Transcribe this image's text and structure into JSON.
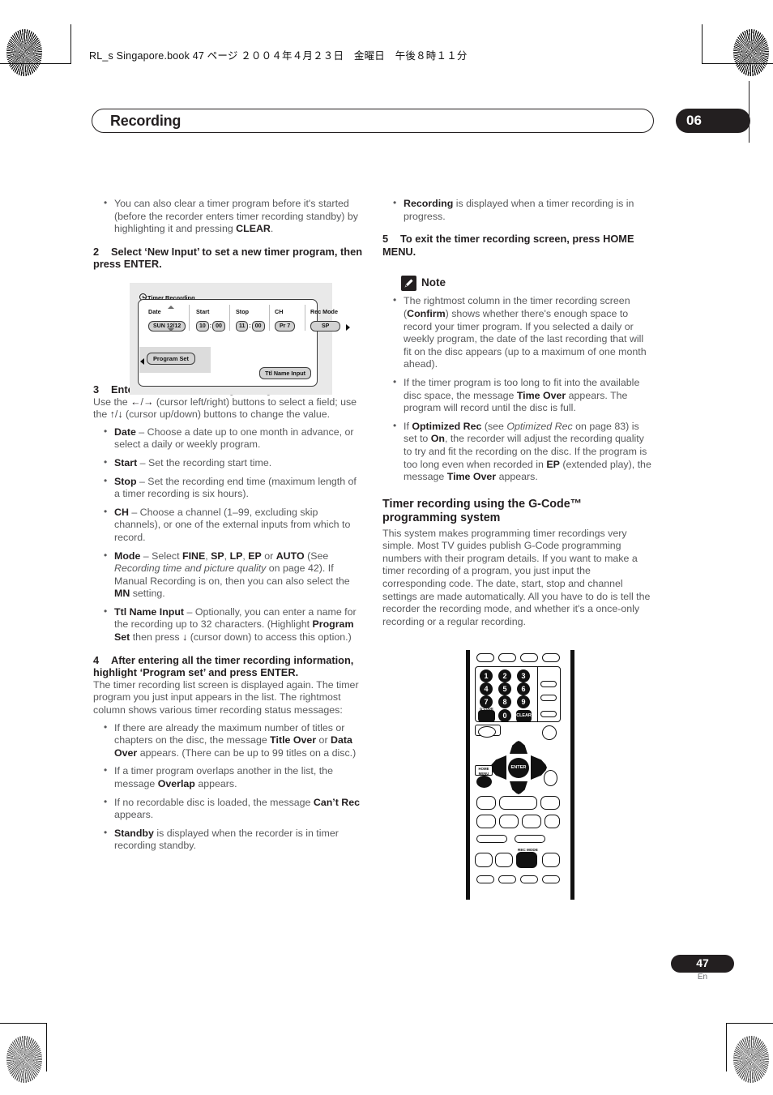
{
  "print_header": "RL_s Singapore.book  47 ページ  ２００４年４月２３日　金曜日　午後８時１１分",
  "running_head": {
    "title": "Recording",
    "chapter_number": "06"
  },
  "footer": {
    "page_number": "47",
    "language": "En"
  },
  "left_column": {
    "intro_bullets": [
      "You can also clear a timer program before it's started (before the recorder enters timer recording standby) by highlighting it and pressing <b>CLEAR</b>."
    ],
    "step2": {
      "number": "2",
      "text": "Select ‘New Input’ to set a new timer program, then press ENTER."
    },
    "osd": {
      "window_title": "Timer Recording",
      "clock_icon": "clock-icon",
      "columns": [
        {
          "label": "Date",
          "value": "SUN 12/12"
        },
        {
          "label": "Start",
          "value_hour": "10",
          "value_min": "00"
        },
        {
          "label": "Stop",
          "value_hour": "11",
          "value_min": "00"
        },
        {
          "label": "CH",
          "value": "Pr 7"
        },
        {
          "label": "Rec Mode",
          "value": "SP"
        }
      ],
      "program_set_button": "Program Set",
      "ttl_name_button": "Ttl Name Input"
    },
    "step3": {
      "number": "3",
      "text": "Enter the timer recording settings.",
      "body": "Use the <b>←</b>/<b>→</b> (cursor left/right) buttons to select a field; use the <b>↑</b>/<b>↓</b> (cursor up/down) buttons to change the value.",
      "bullets": [
        "<b>Date</b> – Choose a date up to one month in advance, or select a daily or weekly program.",
        "<b>Start</b> – Set the recording start time.",
        "<b>Stop</b> – Set the recording end time (maximum length of a timer recording is six hours).",
        "<b>CH</b> – Choose a channel (1–99, excluding skip channels), or one of the external inputs from which to record.",
        "<b>Mode</b> – Select <b>FINE</b>, <b>SP</b>, <b>LP</b>, <b>EP</b> or <b>AUTO</b> (See <i>Recording time and picture quality</i> on page 42). If Manual Recording is on, then you can also select the <b>MN</b> setting.",
        "<b>Ttl Name Input</b> – Optionally, you can enter a name for the recording up to 32 characters. (Highlight <b>Program Set</b> then press <b>↓</b> (cursor down) to access this option.)"
      ]
    },
    "step4": {
      "number": "4",
      "text": "After entering all the timer recording information, highlight ‘Program set’ and press ENTER.",
      "body": "The timer recording list screen is displayed again. The timer program you just input appears in the list. The rightmost column shows various timer recording status messages:",
      "bullets": [
        "If there are already the maximum number of titles or chapters on the disc, the message <b>Title Over</b> or <b>Data Over</b> appears. (There can be up to 99 titles on a disc.)",
        "If a timer program overlaps another in the list, the message <b>Overlap</b> appears.",
        "If no recordable disc is loaded, the message <b>Can’t Rec</b> appears.",
        "<b>Standby</b> is displayed when the recorder is in timer recording standby."
      ]
    }
  },
  "right_column": {
    "top_bullets": [
      "<b>Recording</b> is displayed when a timer recording is in progress."
    ],
    "step5": {
      "number": "5",
      "text": "To exit the timer recording screen, press HOME MENU."
    },
    "note": {
      "icon": "pencil-note-icon",
      "label": "Note",
      "bullets": [
        "The rightmost column in the timer recording screen (<b>Confirm</b>) shows whether there's enough space to record your timer program. If you selected a daily or weekly program, the date of the last recording that will fit on the disc appears (up to a maximum of one month ahead).",
        "If the timer program is too long to fit into the available disc space, the message <b>Time Over</b> appears. The program will record until the disc is full.",
        "If <b>Optimized Rec</b> (see <i>Optimized Rec</i> on page 83) is set to <b>On</b>, the recorder will adjust the recording quality to try and fit the recording on the disc. If the program is too long even when recorded in <b>EP</b> (extended play), the message <b>Time Over</b> appears."
      ]
    },
    "subsection": {
      "heading": "Timer recording using the G-Code™ programming system",
      "body": "This system makes programming timer recordings very simple. Most TV guides publish G-Code programming numbers with their program details. If you want to make a timer recording of a program, you just input the corresponding code. The date, start, stop and channel settings are made automatically. All you have to do is tell the recorder the recording mode, and whether it's a once-only recording or a regular recording."
    },
    "remote": {
      "caption": "remote-control-illustration",
      "number_keys": [
        "1",
        "2",
        "3",
        "4",
        "5",
        "6",
        "7",
        "8",
        "9",
        "0"
      ],
      "gcode_label": "G-CODE",
      "clear_label": "CLEAR",
      "enter_label": "ENTER",
      "home_menu_label": "HOME MENU",
      "rec_mode_label": "REC MODE"
    }
  },
  "colors": {
    "ink": "#231f20",
    "body_grey": "#58595b",
    "osd_pill": "#d2d2d2"
  }
}
